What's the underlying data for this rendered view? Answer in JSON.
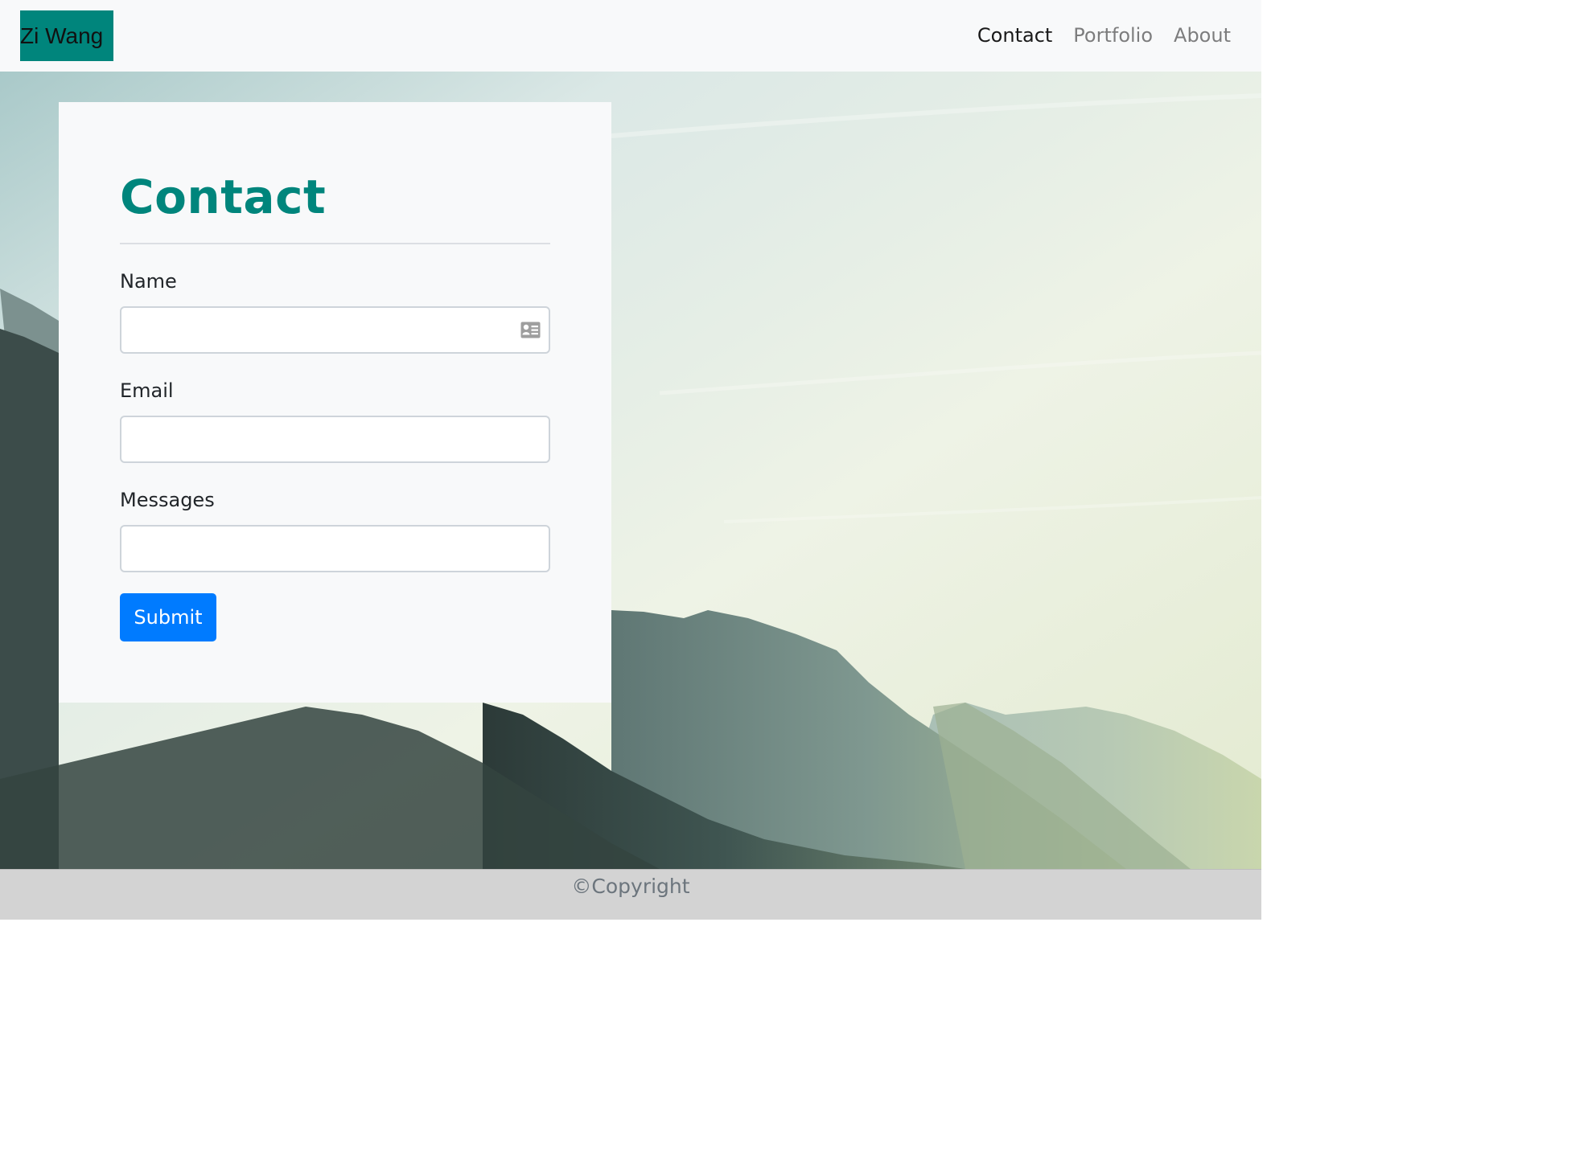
{
  "navbar": {
    "brand": "Zi Wang",
    "links": [
      {
        "label": "Contact",
        "active": true
      },
      {
        "label": "Portfolio",
        "active": false
      },
      {
        "label": "About",
        "active": false
      }
    ]
  },
  "contact": {
    "title": "Contact",
    "fields": {
      "name_label": "Name",
      "name_value": "",
      "name_icon": "contact-card-icon",
      "email_label": "Email",
      "email_value": "",
      "messages_label": "Messages",
      "messages_value": ""
    },
    "submit_label": "Submit"
  },
  "footer": {
    "copyright": "©Copyright"
  },
  "colors": {
    "accent": "#00857c",
    "primary_button": "#007bff",
    "navbar_bg": "#f8f9fa",
    "footer_bg": "#d3d3d3"
  }
}
